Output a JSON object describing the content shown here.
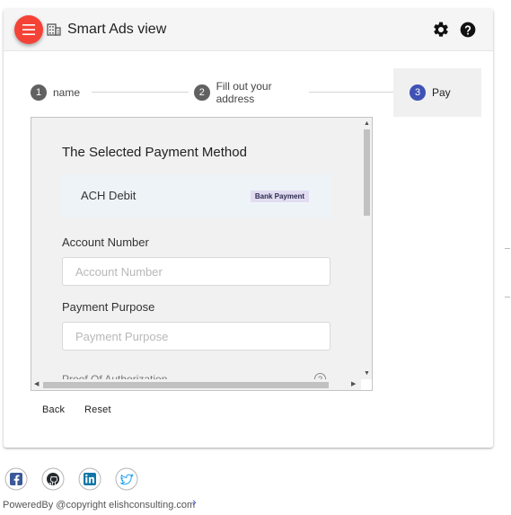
{
  "app": {
    "title": "Smart Ads view",
    "accent_color": "#f44336",
    "primary_color": "#3f51b5"
  },
  "toolbar": {
    "menu_icon": "menu-icon",
    "title_icon": "building-icon",
    "settings_icon": "gear-icon",
    "help_icon": "help-circle-icon"
  },
  "stepper": {
    "steps": [
      {
        "number": "1",
        "label": "name",
        "state": "completed"
      },
      {
        "number": "2",
        "label": "Fill out your address",
        "state": "completed"
      },
      {
        "number": "3",
        "label": "Pay",
        "state": "active"
      }
    ]
  },
  "payment": {
    "heading": "The Selected Payment Method",
    "method_name": "ACH Debit",
    "method_badge": "Bank Payment",
    "account_number_label": "Account Number",
    "account_number_placeholder": "Account Number",
    "account_number_value": "",
    "purpose_label": "Payment Purpose",
    "purpose_placeholder": "Payment Purpose",
    "purpose_value": "",
    "next_label_partial": "Proof Of Authorization"
  },
  "actions": {
    "back_label": "Back",
    "reset_label": "Reset"
  },
  "social": [
    {
      "name": "facebook",
      "icon": "facebook-icon",
      "color": "#3b5998"
    },
    {
      "name": "github",
      "icon": "github-icon",
      "color": "#24292e"
    },
    {
      "name": "linkedin",
      "icon": "linkedin-icon",
      "color": "#0e76a8"
    },
    {
      "name": "twitter",
      "icon": "twitter-icon",
      "color": "#1da1f2"
    }
  ],
  "footer": {
    "text": "PoweredBy @copyright elishconsulting.com"
  }
}
